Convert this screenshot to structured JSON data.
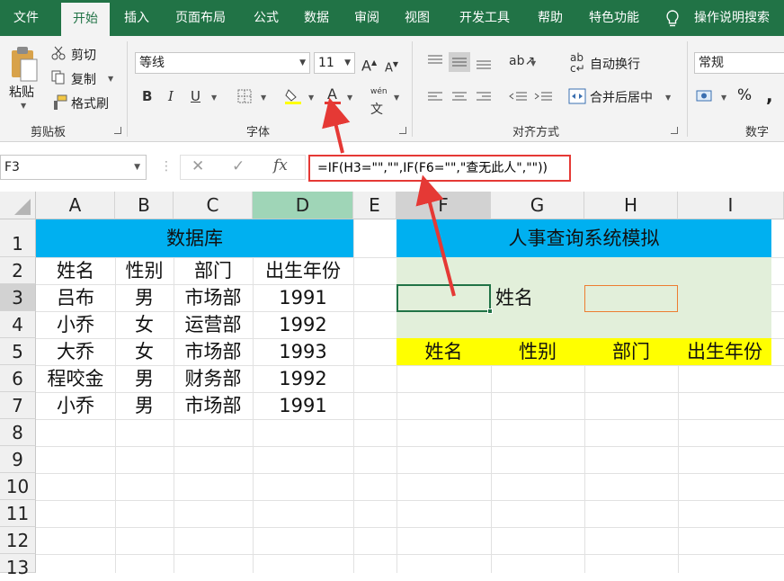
{
  "tabs": [
    "文件",
    "开始",
    "插入",
    "页面布局",
    "公式",
    "数据",
    "审阅",
    "视图",
    "开发工具",
    "帮助",
    "特色功能"
  ],
  "tell_me": "操作说明搜索",
  "clipboard": {
    "paste": "粘贴",
    "cut": "剪切",
    "copy": "复制",
    "format_painter": "格式刷",
    "label": "剪贴板"
  },
  "font": {
    "name": "等线",
    "size": "11",
    "label": "字体",
    "phonetic": "wén"
  },
  "alignment": {
    "wrap": "自动换行",
    "merge": "合并后居中",
    "label": "对齐方式"
  },
  "number": {
    "format": "常规",
    "percent": "%",
    "comma": ",",
    "label": "数字"
  },
  "formula_bar": {
    "name_box": "F3",
    "formula": "=IF(H3=\"\",\"\",IF(F6=\"\",\"查无此人\",\"\"))",
    "fx": "fx"
  },
  "columns": [
    "A",
    "B",
    "C",
    "D",
    "E",
    "F",
    "G",
    "H",
    "I"
  ],
  "rows": [
    "1",
    "2",
    "3",
    "4",
    "5",
    "6",
    "7",
    "8",
    "9",
    "10",
    "11",
    "12",
    "13"
  ],
  "sheet": {
    "db_title": "数据库",
    "db_headers": [
      "姓名",
      "性别",
      "部门",
      "出生年份"
    ],
    "db_rows": [
      [
        "吕布",
        "男",
        "市场部",
        "1991"
      ],
      [
        "小乔",
        "女",
        "运营部",
        "1992"
      ],
      [
        "大乔",
        "女",
        "市场部",
        "1993"
      ],
      [
        "程咬金",
        "男",
        "财务部",
        "1992"
      ],
      [
        "小乔",
        "男",
        "市场部",
        "1991"
      ]
    ],
    "query_title": "人事查询系统模拟",
    "query_name_label": "姓名",
    "result_headers": [
      "姓名",
      "性别",
      "部门",
      "出生年份"
    ]
  },
  "colors": {
    "excel_green": "#217346",
    "header_blue": "#00b0f0",
    "query_bg": "#e2efda",
    "result_yellow": "#ffff00",
    "annotation_red": "#e53935"
  }
}
